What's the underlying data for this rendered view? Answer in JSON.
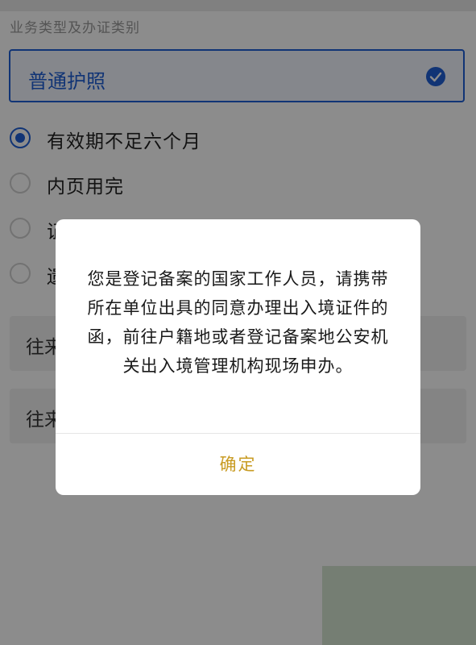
{
  "form": {
    "section_label": "业务类型及办证类别",
    "selected_type": "普通护照",
    "options": [
      {
        "label": "有效期不足六个月",
        "checked": true
      },
      {
        "label": "内页用完",
        "checked": false
      },
      {
        "label": "证",
        "checked": false
      },
      {
        "label": "遗",
        "checked": false
      }
    ],
    "cards": [
      {
        "label": "往来"
      },
      {
        "label": "往来"
      }
    ]
  },
  "dialog": {
    "message": "您是登记备案的国家工作人员，请携带所在单位出具的同意办理出入境证件的函，前往户籍地或者登记备案地公安机关出入境管理机构现场申办。",
    "confirm_label": "确定"
  },
  "colors": {
    "accent": "#1f5fd6",
    "confirm": "#c89b22"
  }
}
